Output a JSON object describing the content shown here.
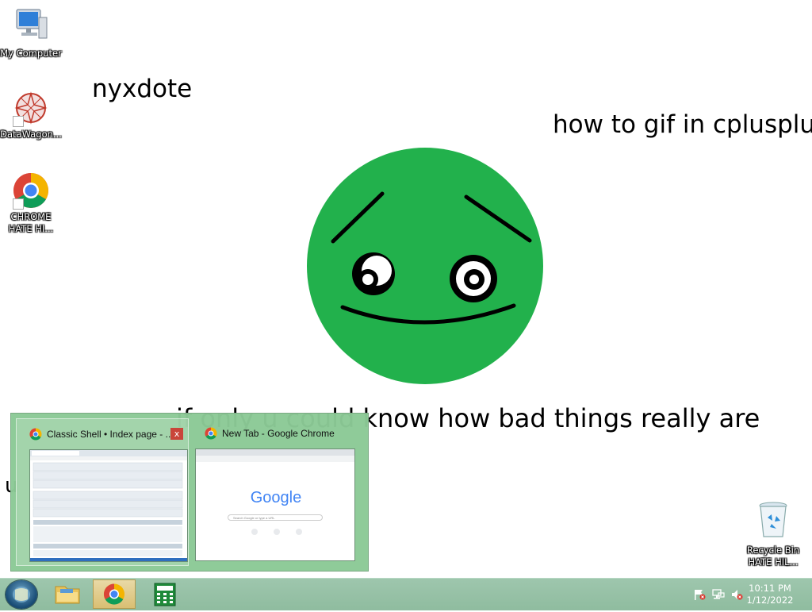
{
  "wallpaper": {
    "text_top_left": "nyxdote",
    "text_top_right": "how to gif in cplusplus",
    "text_bottom": "if only u could know how bad things really are",
    "text_left_fragment": "u"
  },
  "desktop_icons": [
    {
      "label": "My Computer",
      "icon": "computer-icon"
    },
    {
      "label": "DataWagon...",
      "icon": "datawagon-icon"
    },
    {
      "label": "CHROME HATE HI...",
      "icon": "chrome-icon"
    },
    {
      "label": "Recycle Bin HATE HIL...",
      "icon": "recycle-bin-icon"
    }
  ],
  "thumbnails": [
    {
      "title": "Classic Shell • Index page - ...",
      "icon": "chrome-icon",
      "close": "x"
    },
    {
      "title": "New Tab - Google Chrome",
      "icon": "chrome-icon"
    }
  ],
  "preview_google": {
    "logo": "Google",
    "search_placeholder": "Search Google or type a URL"
  },
  "taskbar": {
    "items": [
      "start-orb",
      "file-explorer",
      "google-chrome",
      "calculator"
    ],
    "clock_time": "10:11 PM",
    "clock_date": "1/12/2022"
  },
  "colors": {
    "smiley_green": "#22b14c",
    "taskbar": "#95c1a5",
    "thumbnail_popup": "#8bc996",
    "taskbar_active": "#dcc47f"
  }
}
